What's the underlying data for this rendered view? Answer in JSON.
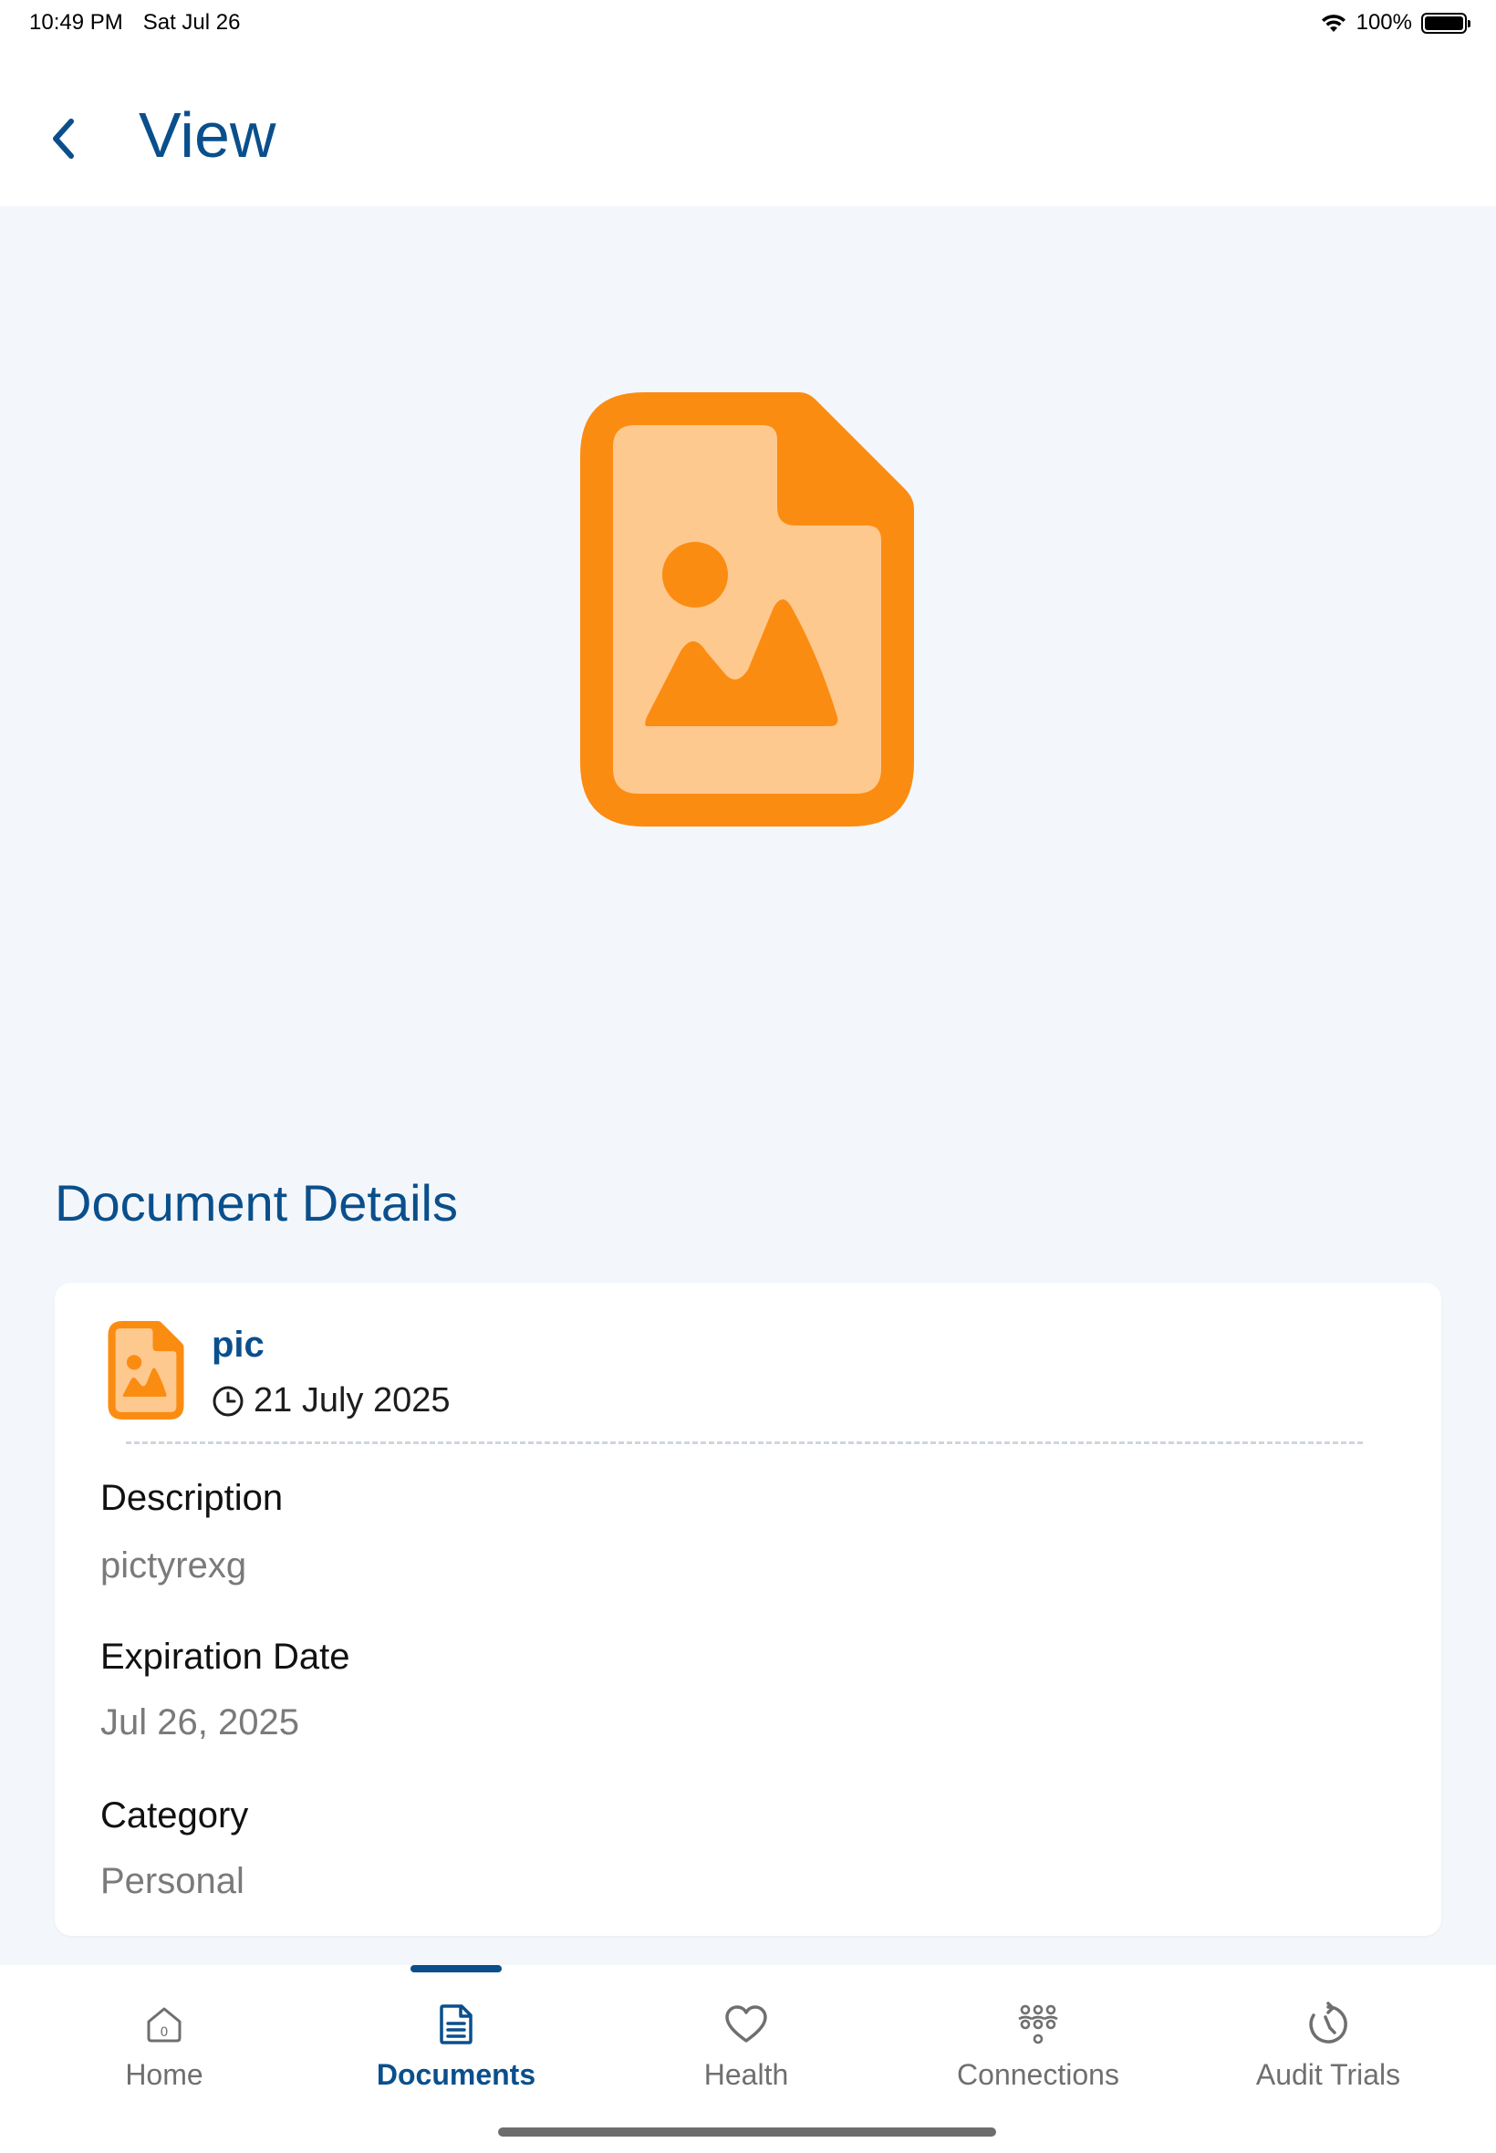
{
  "status_bar": {
    "time": "10:49 PM",
    "date": "Sat Jul 26",
    "battery": "100%"
  },
  "header": {
    "title": "View",
    "back_icon": "chevron-left-icon"
  },
  "preview": {
    "icon": "image-file-icon",
    "colors": {
      "outer": "#fb8c12",
      "inner": "#fec98f"
    }
  },
  "details": {
    "title": "Document Details",
    "document": {
      "name": "pic",
      "date": "21 July 2025",
      "icon": "image-file-icon"
    },
    "fields": [
      {
        "label": "Description",
        "value": "pictyrexg"
      },
      {
        "label": "Expiration Date",
        "value": "Jul 26, 2025"
      },
      {
        "label": "Category",
        "value": "Personal"
      }
    ]
  },
  "tabs": [
    {
      "label": "Home",
      "icon": "home-icon",
      "active": false
    },
    {
      "label": "Documents",
      "icon": "document-icon",
      "active": true
    },
    {
      "label": "Health",
      "icon": "heart-icon",
      "active": false
    },
    {
      "label": "Connections",
      "icon": "connections-icon",
      "active": false
    },
    {
      "label": "Audit Trials",
      "icon": "history-icon",
      "active": false
    }
  ],
  "colors": {
    "primary": "#0a4f8c",
    "background": "#f3f7fb",
    "accent": "#fb8c12"
  }
}
